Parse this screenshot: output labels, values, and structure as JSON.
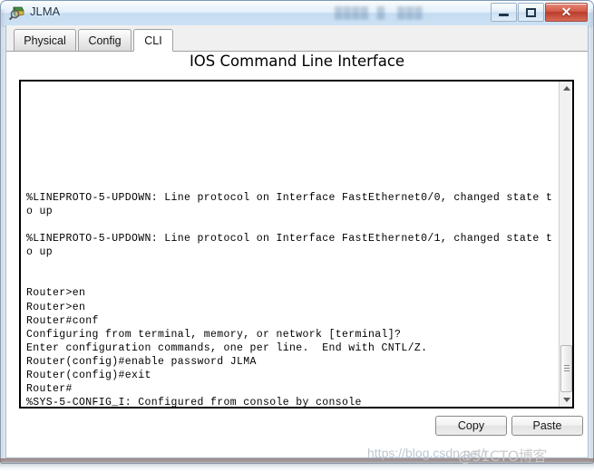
{
  "window": {
    "title": "JLMA",
    "icon": "packet-tracer-device-icon",
    "titlebar_ghost_text": "",
    "controls": {
      "minimize_label": "–",
      "maximize_label": "□",
      "close_label": "✕"
    }
  },
  "tabs": [
    {
      "label": "Physical",
      "active": false
    },
    {
      "label": "Config",
      "active": false
    },
    {
      "label": "CLI",
      "active": true
    }
  ],
  "heading": "IOS Command Line Interface",
  "terminal": {
    "lines": [
      "",
      "",
      "",
      "",
      "",
      "",
      "",
      "",
      "%LINEPROTO-5-UPDOWN: Line protocol on Interface FastEthernet0/0, changed state t",
      "o up",
      "",
      "%LINEPROTO-5-UPDOWN: Line protocol on Interface FastEthernet0/1, changed state t",
      "o up",
      "",
      "",
      "Router>en",
      "Router>en",
      "Router#conf",
      "Configuring from terminal, memory, or network [terminal]?",
      "Enter configuration commands, one per line.  End with CNTL/Z.",
      "Router(config)#enable password JLMA",
      "Router(config)#exit",
      "Router#",
      "%SYS-5-CONFIG_I: Configured from console by console"
    ],
    "scrollbar": {
      "up_arrow": "scroll-up-arrow-icon",
      "down_arrow": "scroll-down-arrow-icon",
      "thumb_position_percent": 85
    }
  },
  "buttons": {
    "copy_label": "Copy",
    "paste_label": "Paste"
  },
  "watermarks": {
    "url": "https://blog.csdn.net/r",
    "brand": "@51CTO博客"
  },
  "colors": {
    "title_bar_glass": "#cfe0f2",
    "frame_border": "#7c99b6",
    "close_button": "#c24a35",
    "terminal_bg": "#ffffff",
    "terminal_text": "#000000",
    "tab_active_bg": "#ffffff",
    "tab_inactive_bg": "#eaeaea"
  }
}
